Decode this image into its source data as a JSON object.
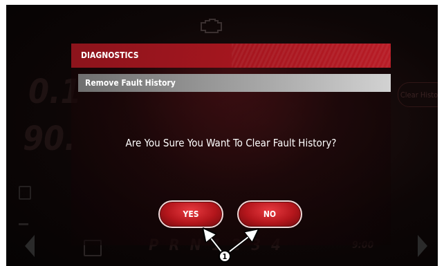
{
  "dialog": {
    "title": "DIAGNOSTICS",
    "subtitle": "Remove Fault History",
    "question": "Are You Sure You Want To Clear Fault History?",
    "yes_label": "YES",
    "no_label": "NO"
  },
  "background": {
    "speed_1": "0.1",
    "speed_2": "90.",
    "clear_button_label": "Clear History",
    "gears": "P R N 1 2 3 4",
    "time": "9:00"
  },
  "callout": {
    "number": "1"
  },
  "colors": {
    "title_bar": "#a6161f",
    "button": "#c8161d"
  },
  "icons": [
    "check-engine-icon",
    "fuel-gauge-icon",
    "coolant-temp-icon",
    "calendar-icon",
    "nav-left-icon",
    "nav-right-icon"
  ]
}
